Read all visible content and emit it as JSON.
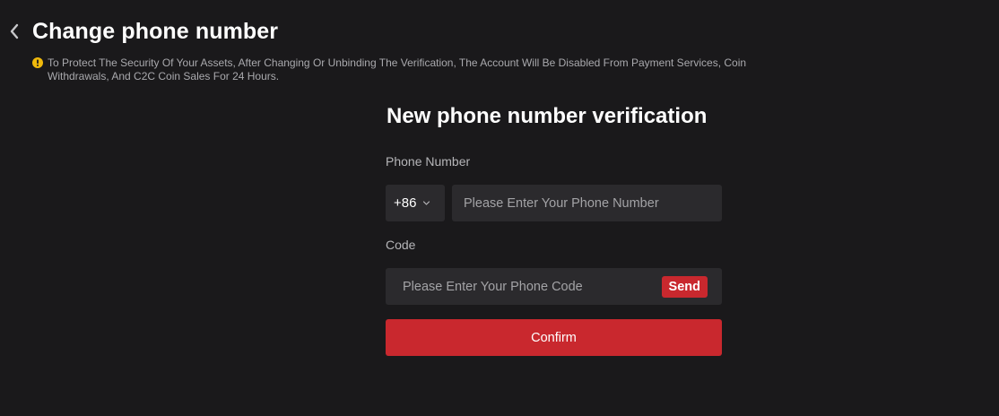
{
  "header": {
    "title": "Change phone number",
    "back_icon": "chevron-left-icon"
  },
  "notice": {
    "icon": "warning-icon",
    "icon_color": "#f0b90b",
    "text": "To Protect The Security Of Your Assets, After Changing Or Unbinding The Verification, The Account Will Be Disabled From Payment Services, Coin Withdrawals, And C2C Coin Sales For 24 Hours."
  },
  "form": {
    "title": "New phone number verification",
    "phone_label": "Phone Number",
    "country_code": "+86",
    "phone_placeholder": "Please Enter Your Phone Number",
    "code_label": "Code",
    "code_placeholder": "Please Enter Your Phone Code",
    "send_label": "Send",
    "confirm_label": "Confirm"
  },
  "colors": {
    "background": "#1a191b",
    "input_background": "#2b2a2d",
    "accent": "#c9282e"
  }
}
